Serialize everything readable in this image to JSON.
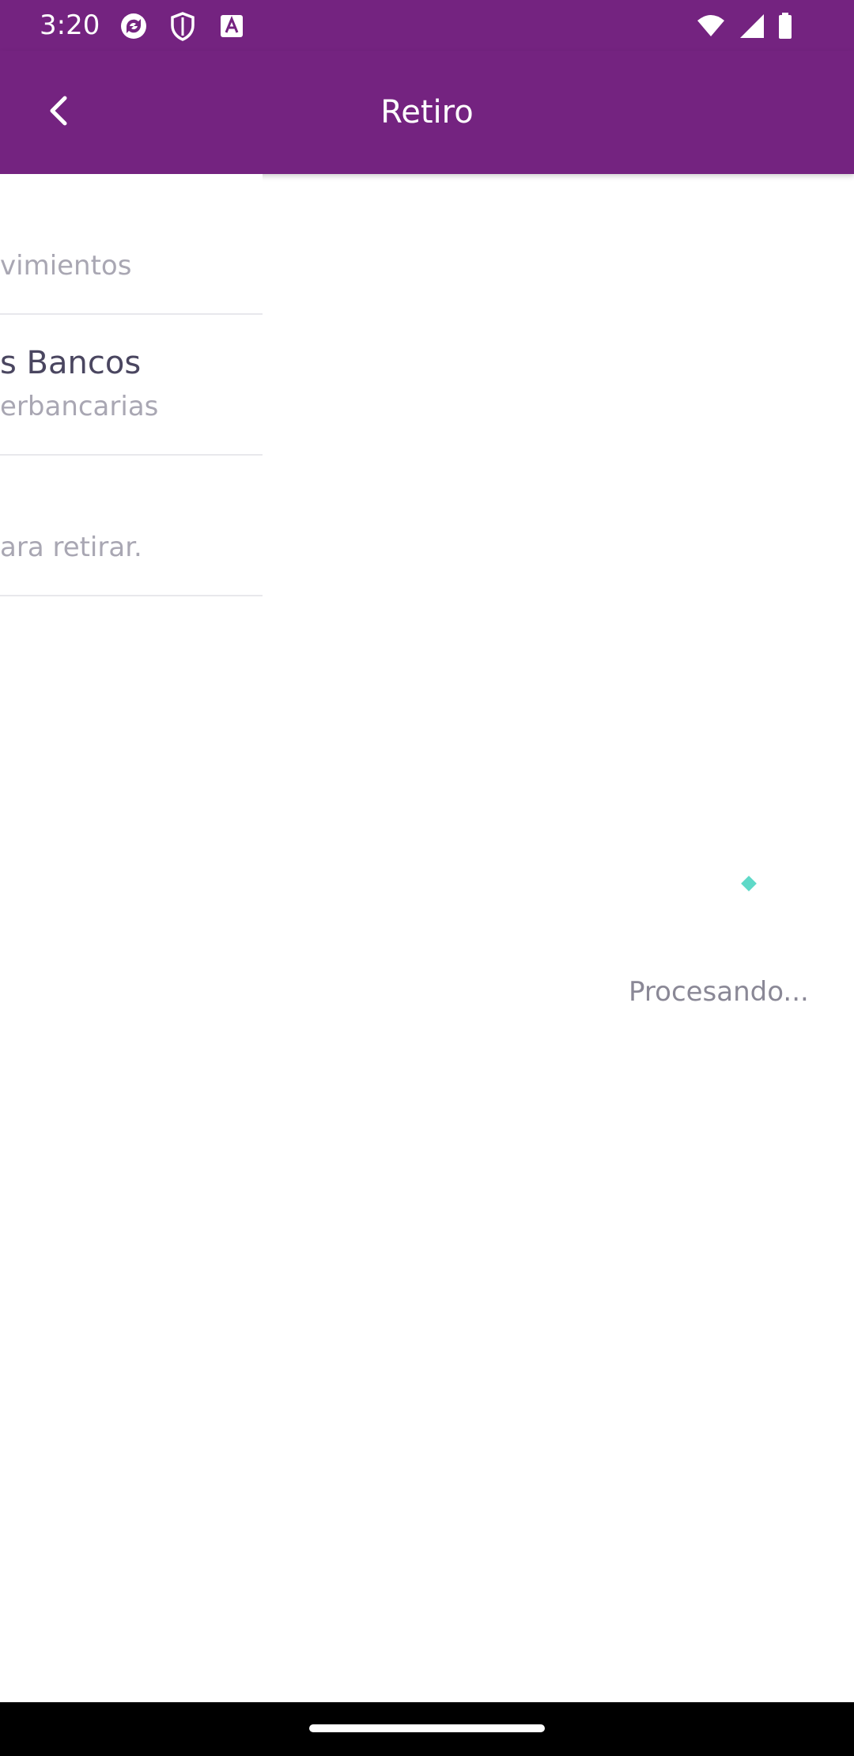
{
  "status_bar": {
    "time": "3:20",
    "icons_left": [
      "sync-app-icon",
      "shield-icon",
      "a-badge-icon"
    ],
    "icons_right": [
      "wifi-icon",
      "cell-signal-icon",
      "battery-icon"
    ]
  },
  "app_bar": {
    "title": "Retiro",
    "back_icon": "chevron-left-icon",
    "background": "#742380"
  },
  "menu": {
    "items": [
      {
        "title": "",
        "subtitle": "vimientos"
      },
      {
        "title": "s Bancos",
        "subtitle": "erbancarias"
      },
      {
        "title": "",
        "subtitle": "ara retirar."
      }
    ]
  },
  "loader": {
    "text": "Procesando...",
    "accent": "#5fd9c8"
  },
  "nav_bar": {
    "home_indicator": "home-indicator"
  }
}
